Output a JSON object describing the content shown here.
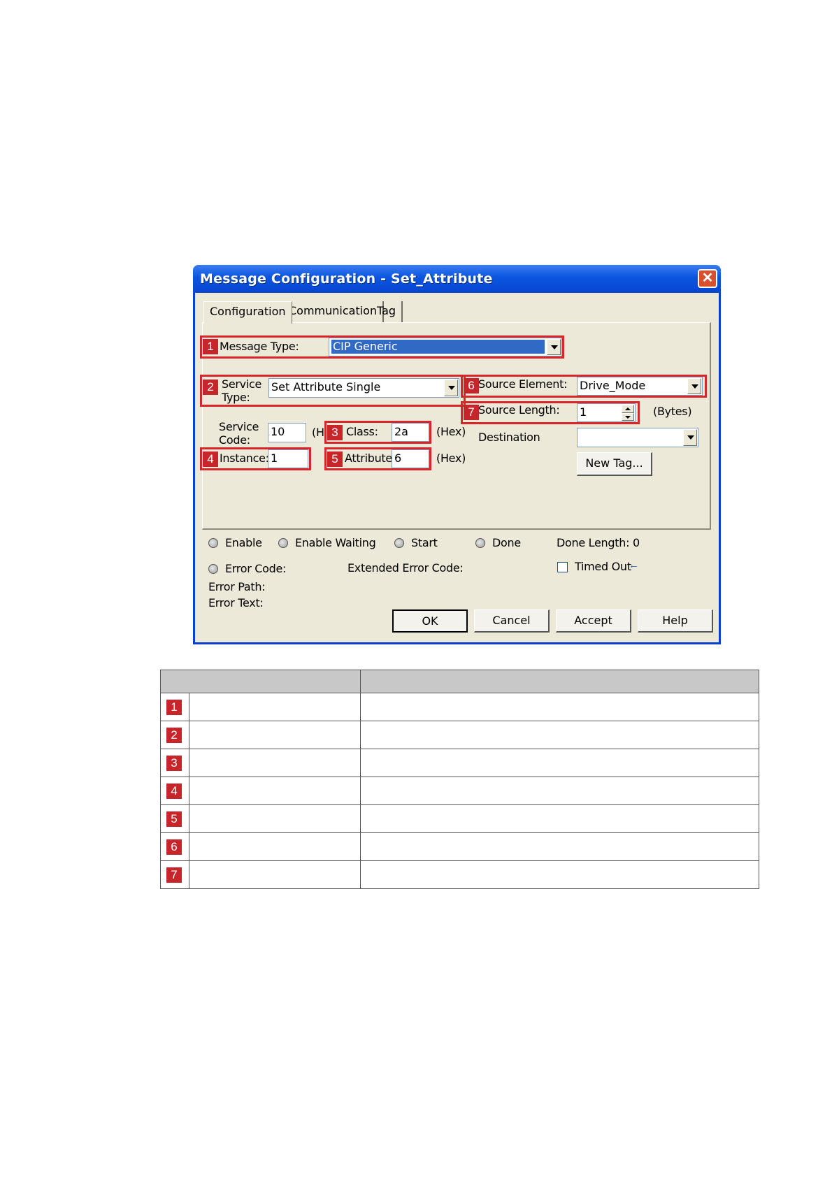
{
  "window": {
    "title": "Message Configuration - Set_Attribute",
    "close_icon": "close-icon"
  },
  "tabs": [
    {
      "label": "Configuration",
      "active": true
    },
    {
      "label": "Communication",
      "active": false
    },
    {
      "label": "Tag",
      "active": false
    }
  ],
  "config": {
    "message_type": {
      "label": "Message Type:",
      "value": "CIP Generic"
    },
    "service_type": {
      "label_line1": "Service",
      "label_line2": "Type:",
      "value": "Set Attribute Single"
    },
    "service_code": {
      "label_line1": "Service",
      "label_line2": "Code:",
      "value": "10",
      "unit": "(H"
    },
    "class": {
      "label": "Class:",
      "value": "2a",
      "unit": "(Hex)"
    },
    "instance": {
      "label": "Instance:",
      "value": "1"
    },
    "attribute": {
      "label": "Attribute:",
      "value": "6",
      "unit": "(Hex)"
    },
    "source_element": {
      "label": "Source Element:",
      "value": "Drive_Mode"
    },
    "source_length": {
      "label": "Source Length:",
      "value": "1",
      "unit": "(Bytes)"
    },
    "destination": {
      "label": "Destination",
      "value": ""
    },
    "new_tag_button": "New Tag..."
  },
  "status": {
    "enable": "Enable",
    "enable_waiting": "Enable Waiting",
    "start": "Start",
    "done": "Done",
    "done_length": "Done Length: 0",
    "error_code": "Error Code:",
    "extended_error_code": "Extended Error Code:",
    "timed_out": "Timed Out",
    "error_path": "Error Path:",
    "error_text": "Error Text:"
  },
  "buttons": {
    "ok": "OK",
    "cancel": "Cancel",
    "accept": "Accept",
    "help": "Help"
  },
  "badges": [
    "1",
    "2",
    "3",
    "4",
    "5",
    "6",
    "7"
  ],
  "colors": {
    "title_bar": "#0a55e0",
    "highlight_box": "#d8262b",
    "badge": "#c8252a",
    "selection": "#316ac5"
  }
}
